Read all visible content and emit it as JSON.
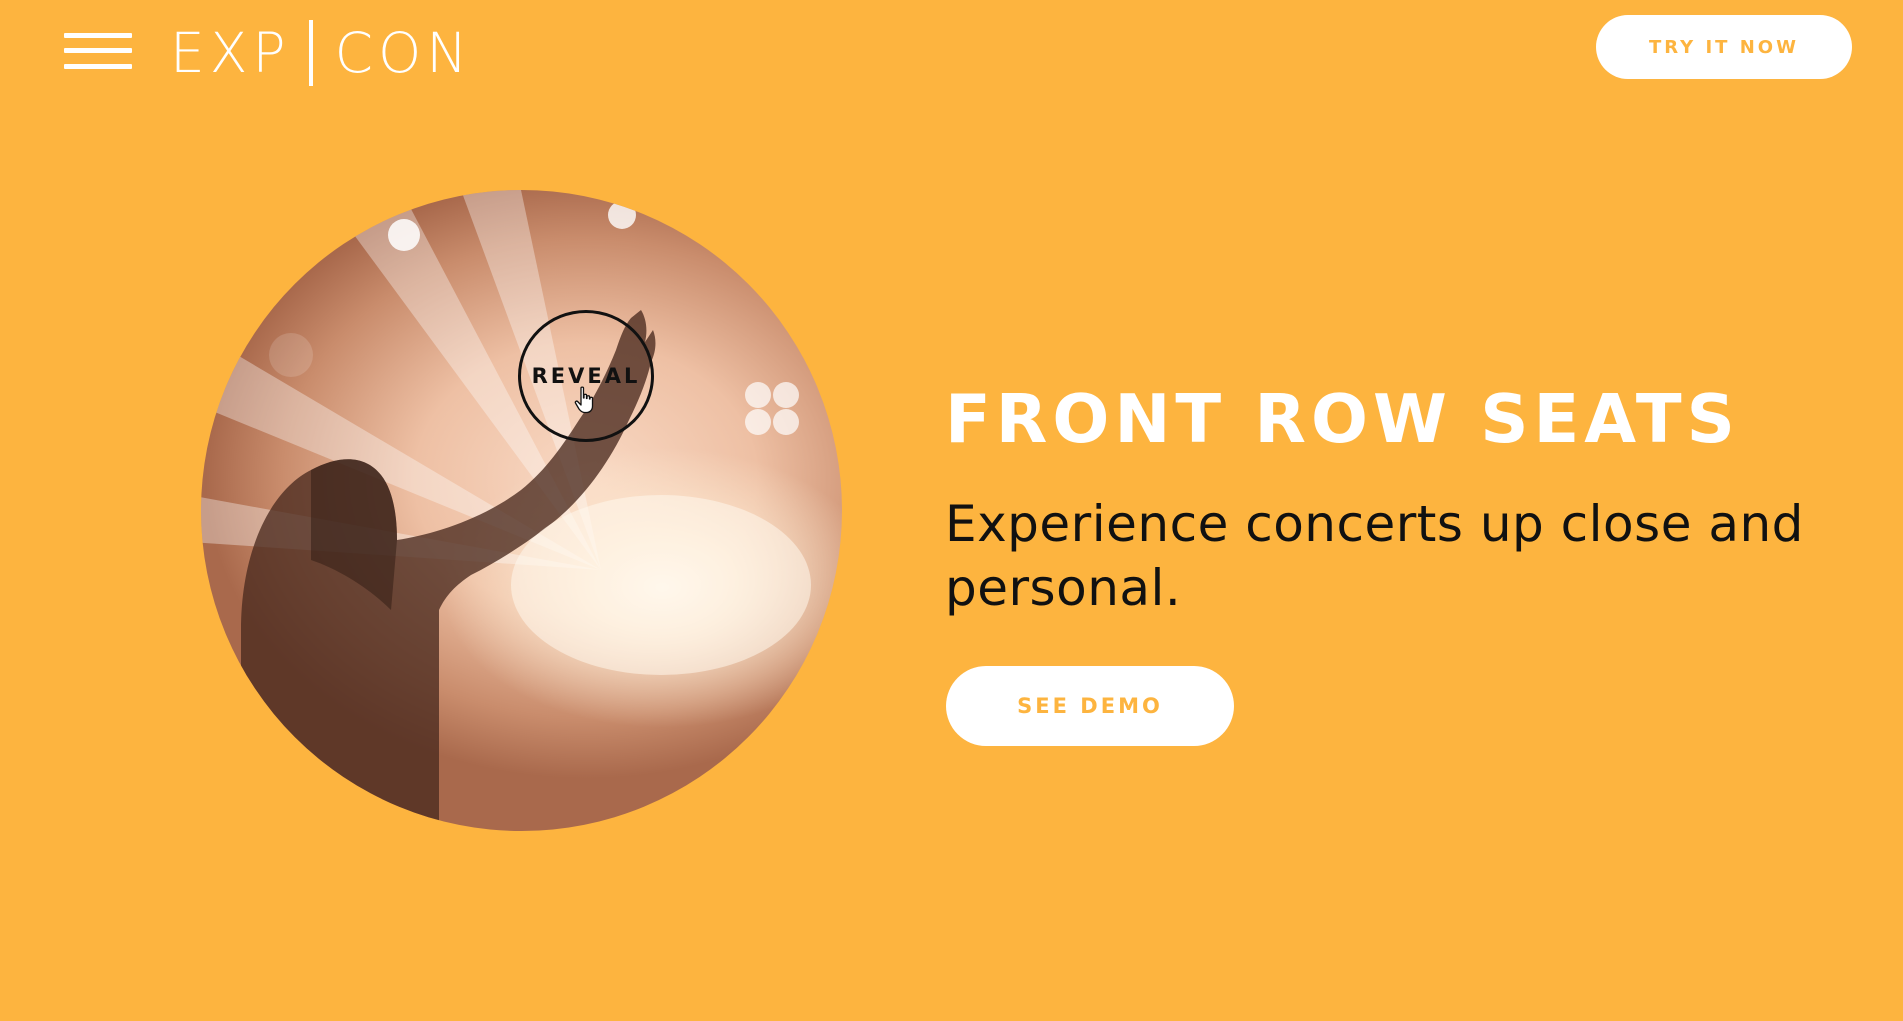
{
  "colors": {
    "background": "#FDB43F",
    "button_background": "#FFFFFF",
    "button_text": "#FDB43F",
    "headline": "#FFFFFF",
    "body_text": "#111111"
  },
  "header": {
    "menu_icon": "hamburger-menu-icon",
    "logo_left": "EXP",
    "logo_right": "CON",
    "cta_label": "TRY IT NOW"
  },
  "hero": {
    "image_description_icon": "concert-photo",
    "reveal_label": "REVEAL",
    "cursor_icon": "pointer-hand-icon",
    "headline": "FRONT ROW SEATS",
    "subheadline": "Experience concerts up close and personal.",
    "demo_label": "SEE DEMO"
  }
}
